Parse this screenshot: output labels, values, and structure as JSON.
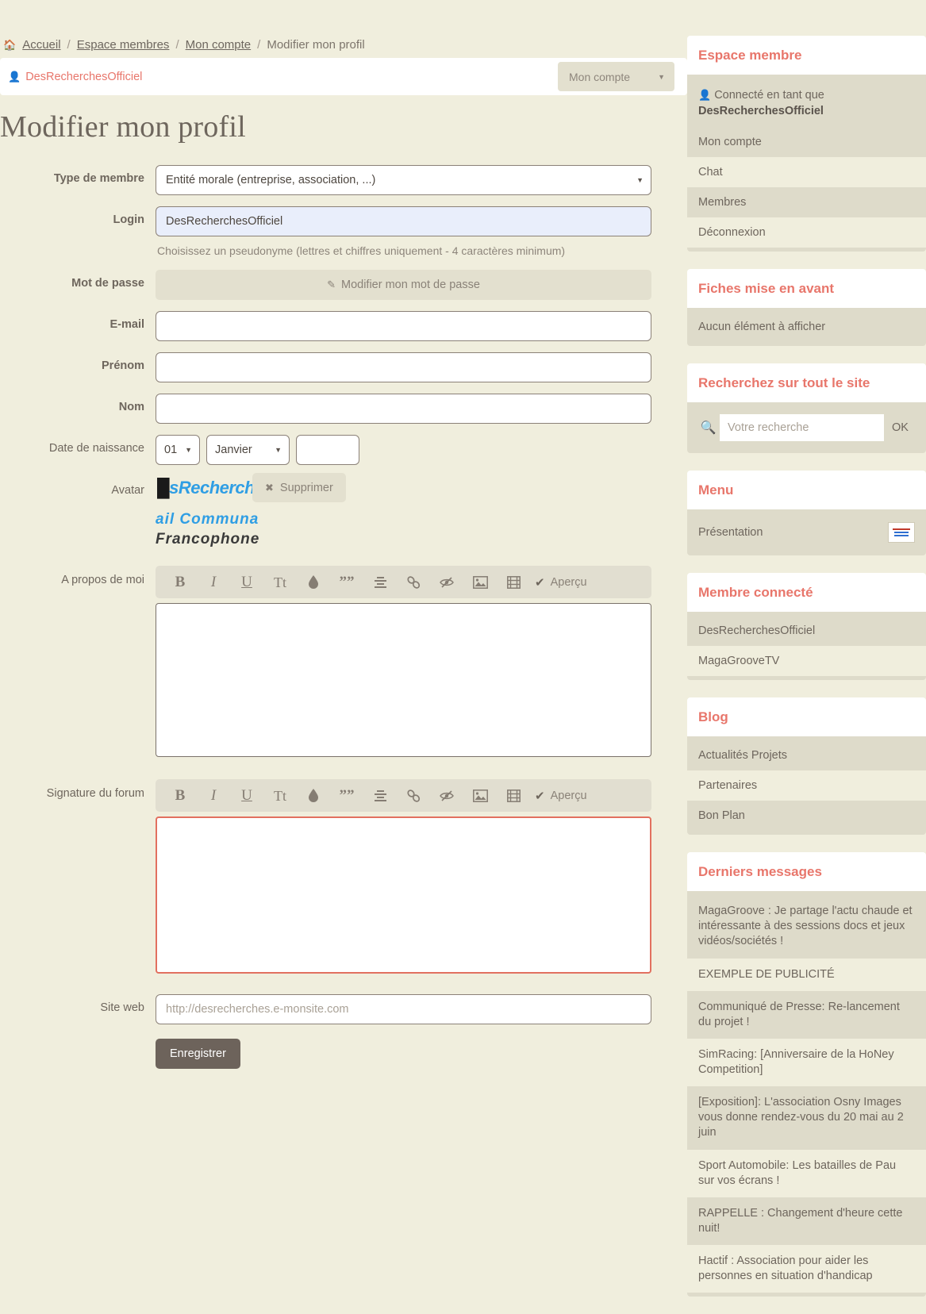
{
  "breadcrumb": {
    "home_icon": "home-icon",
    "items": [
      {
        "label": "Accueil",
        "link": true
      },
      {
        "label": "Espace membres",
        "link": true
      },
      {
        "label": "Mon compte",
        "link": true
      },
      {
        "label": "Modifier mon profil",
        "link": false
      }
    ],
    "separator": "/"
  },
  "userbar": {
    "username": "DesRecherchesOfficiel",
    "account_select": "Mon compte"
  },
  "page_title": "Modifier mon profil",
  "form": {
    "member_type": {
      "label": "Type de membre",
      "value": "Entité morale (entreprise, association, ...)"
    },
    "login": {
      "label": "Login",
      "value": "DesRecherchesOfficiel",
      "hint": "Choisissez un pseudonyme (lettres et chiffres uniquement - 4 caractères minimum)"
    },
    "password": {
      "label": "Mot de passe",
      "button": "Modifier mon mot de passe"
    },
    "email": {
      "label": "E-mail",
      "value": ""
    },
    "firstname": {
      "label": "Prénom",
      "value": ""
    },
    "lastname": {
      "label": "Nom",
      "value": ""
    },
    "birthdate": {
      "label": "Date de naissance",
      "day": "01",
      "month": "Janvier",
      "year": ""
    },
    "avatar": {
      "label": "Avatar",
      "logo_line1": "sRecherche.",
      "logo_line2": "ail Communa",
      "logo_line3": "Francophone",
      "delete_button": "Supprimer"
    },
    "about": {
      "label": "A propos de moi",
      "value": ""
    },
    "signature": {
      "label": "Signature du forum",
      "value": ""
    },
    "website": {
      "label": "Site web",
      "placeholder": "http://desrecherches.e-monsite.com",
      "value": ""
    },
    "submit": "Enregistrer"
  },
  "editor_toolbar": {
    "bold": "B",
    "italic": "I",
    "underline": "U",
    "textsize": "Tt",
    "color_icon": "droplet-icon",
    "quote": "””",
    "align_icon": "align-center-icon",
    "link_icon": "link-icon",
    "hide_icon": "eye-slash-icon",
    "image_icon": "image-icon",
    "video_icon": "film-icon",
    "preview": "Aperçu"
  },
  "sidebar": {
    "espace_membre": {
      "title": "Espace membre",
      "connected_prefix": "Connecté en tant que",
      "connected_user": "DesRecherchesOfficiel",
      "items": [
        "Mon compte",
        "Chat",
        "Membres",
        "Déconnexion"
      ]
    },
    "fiches": {
      "title": "Fiches mise en avant",
      "empty": "Aucun élément à afficher"
    },
    "search": {
      "title": "Recherchez sur tout le site",
      "placeholder": "Votre recherche",
      "value": "",
      "ok": "OK",
      "icon": "search-icon"
    },
    "menu": {
      "title": "Menu",
      "items": [
        {
          "label": "Présentation",
          "thumb": true
        }
      ]
    },
    "membre_connecte": {
      "title": "Membre connecté",
      "items": [
        "DesRecherchesOfficiel",
        "MagaGrooveTV"
      ]
    },
    "blog": {
      "title": "Blog",
      "items": [
        "Actualités Projets",
        "Partenaires",
        "Bon Plan"
      ]
    },
    "derniers_messages": {
      "title": "Derniers messages",
      "items": [
        "MagaGroove : Je partage l'actu chaude et intéressante à des sessions docs et jeux vidéos/sociétés !",
        "EXEMPLE DE PUBLICITÉ",
        "Communiqué de Presse: Re-lancement du projet !",
        "SimRacing: [Anniversaire de la HoNey Competition]",
        "[Exposition]: L'association Osny Images vous donne rendez-vous du 20 mai au 2 juin",
        "Sport Automobile: Les batailles de Pau sur vos écrans !",
        "RAPPELLE : Changement d'heure cette nuit!",
        "Hactif : Association pour aider les personnes en situation d'handicap"
      ]
    }
  },
  "colors": {
    "page_bg": "#f0eedd",
    "accent": "#e8766b",
    "widget_body": "#dedbca",
    "text": "#6e665d",
    "save_button": "#6d635b",
    "focus_border": "#e2705f",
    "login_field_bg": "#e9eefb",
    "logo_blue": "#2f9ee4"
  }
}
